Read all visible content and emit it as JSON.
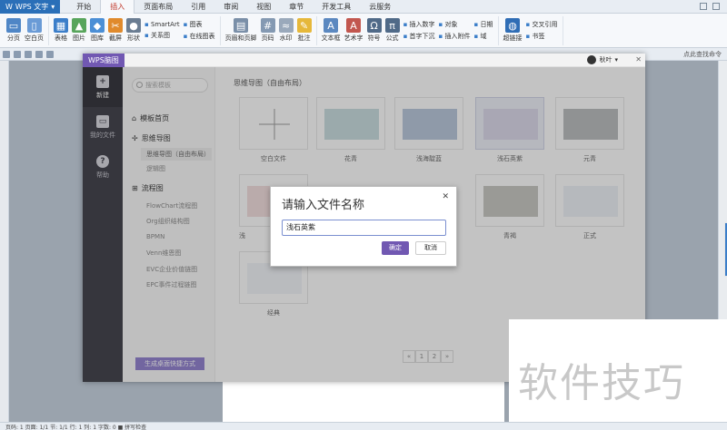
{
  "app": {
    "title": "WPS 文字"
  },
  "ribbon_tabs": [
    "开始",
    "插入",
    "页面布局",
    "引用",
    "审阅",
    "视图",
    "章节",
    "开发工具",
    "云服务"
  ],
  "active_tab": "插入",
  "ribbon": {
    "page_break": "分页",
    "blank_page": "空白页",
    "table": "表格",
    "picture": "图片",
    "gallery": "图库",
    "screenshot": "截屏",
    "shape": "形状",
    "smartart": "SmartArt",
    "relation": "关系图",
    "chart": "图表",
    "online_chart": "在线图表",
    "header_footer": "页眉和页脚",
    "page_number": "页码",
    "watermark": "水印",
    "comment": "批注",
    "textbox": "文本框",
    "wordart": "艺术字",
    "symbol": "符号",
    "formula": "公式",
    "insert_number": "插入数字",
    "object": "对象",
    "date": "日期",
    "first_letter": "首字下沉",
    "attachment": "插入附件",
    "field": "域",
    "hyperlink": "超链接",
    "cross_ref": "交叉引用",
    "bookmark": "书签"
  },
  "user": {
    "name": "秋叶"
  },
  "quickbar": {
    "search_label": "点此查找命令"
  },
  "statusbar": {
    "text": "页码: 1  页面: 1/1  节: 1/1  行: 1  列: 1  字数: 0  ■ 拼写检查"
  },
  "mindmap_window": {
    "badge": "WPS脑图",
    "user": "秋叶",
    "nav": [
      {
        "label": "新建",
        "icon": "new-file-icon"
      },
      {
        "label": "我的文件",
        "icon": "folder-icon"
      },
      {
        "label": "帮助",
        "icon": "help-icon"
      }
    ],
    "search_placeholder": "搜索模板",
    "sections": {
      "home": "模板首页",
      "mindmap": "思维导图",
      "mindmap_free": "思维导图（自由布局）",
      "logic": "逻辑图",
      "flow": "流程图",
      "flowchart": "FlowChart流程图",
      "org": "Org组织结构图",
      "bpmn": "BPMN",
      "venn": "Venn维恩图",
      "evc": "EVC企业价值链图",
      "epc": "EPC事件过程链图"
    },
    "gen_shortcut": "生成桌面快捷方式",
    "content_title": "思维导图（自由布局）",
    "templates_row1": [
      "空白文件",
      "花青",
      "浅海靛蓝",
      "浅石英紫",
      "元青"
    ],
    "templates_row2": [
      "浅",
      "",
      "",
      "青褐",
      "正式"
    ],
    "templates_row3": [
      "经典"
    ],
    "pager": [
      "«",
      "1",
      "2",
      "»"
    ]
  },
  "dialog": {
    "title": "请输入文件名称",
    "input_value": "浅石英紫",
    "ok": "确定",
    "cancel": "取消"
  },
  "watermark_text": "软件技巧"
}
